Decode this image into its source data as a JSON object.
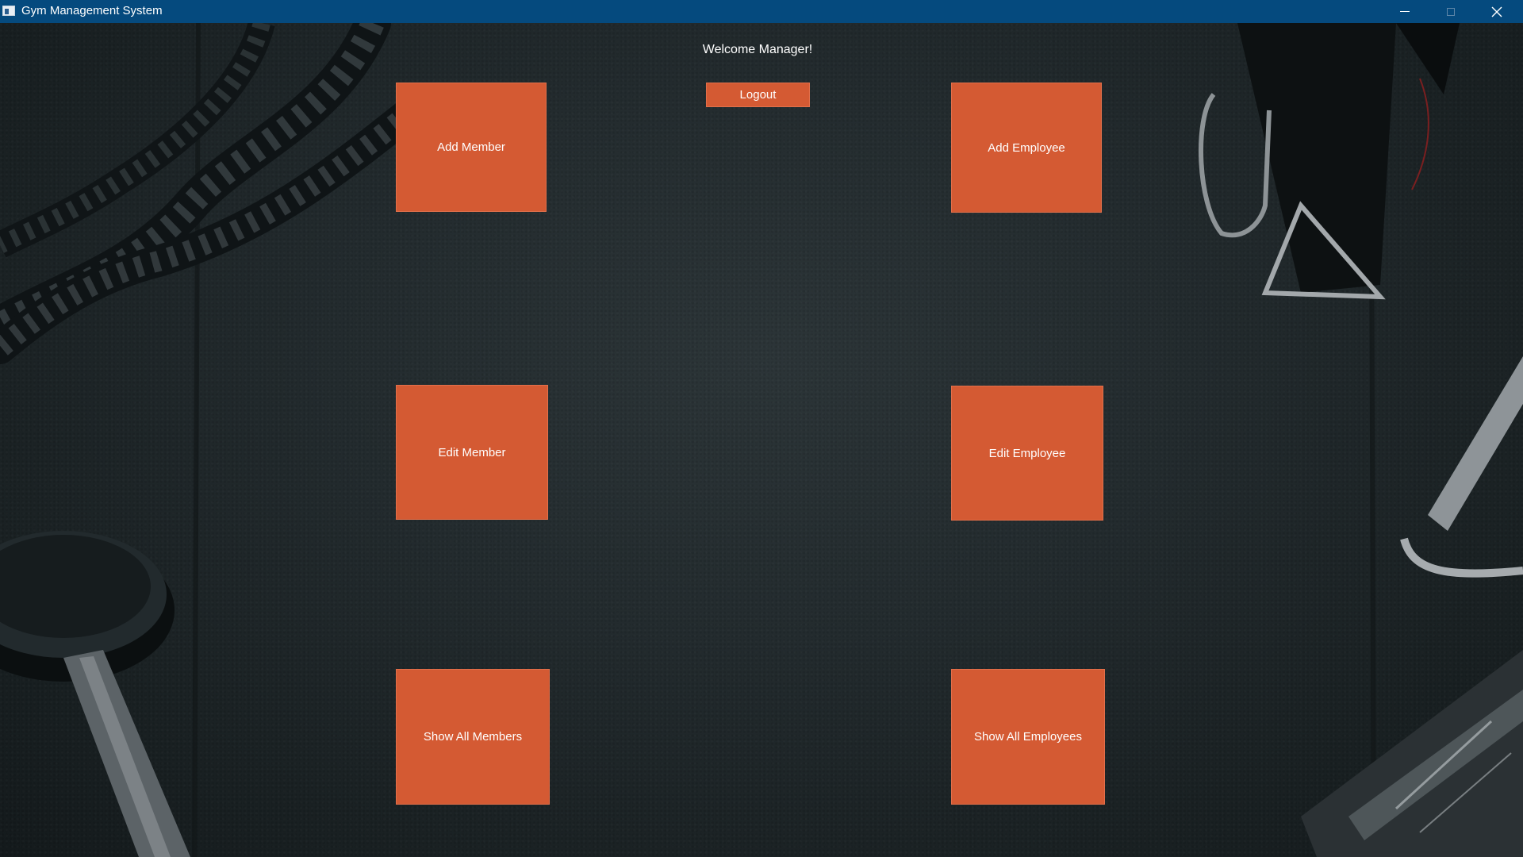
{
  "window": {
    "title": "Gym Management System",
    "icons": [
      "app-icon",
      "minimize-icon",
      "maximize-icon",
      "close-icon"
    ]
  },
  "header": {
    "welcome_text": "Welcome Manager!",
    "logout_label": "Logout"
  },
  "members": {
    "add_label": "Add Member",
    "edit_label": "Edit Member",
    "show_all_label": "Show All Members"
  },
  "employees": {
    "add_label": "Add Employee",
    "edit_label": "Edit Employee",
    "show_all_label": "Show All Employees"
  },
  "colors": {
    "titlebar": "#054a7e",
    "tile": "#d45a33",
    "text": "#ffffff"
  }
}
